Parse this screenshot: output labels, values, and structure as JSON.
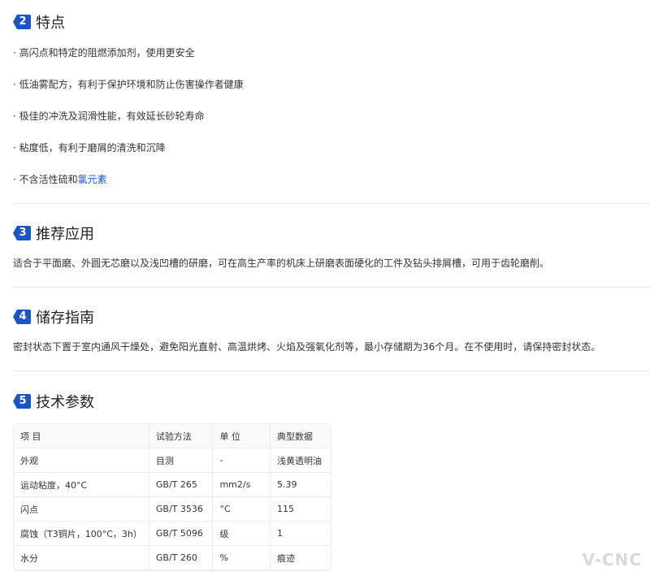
{
  "features": {
    "number": "2",
    "title": "特点",
    "items": [
      {
        "text": "· 高闪点和特定的阻燃添加剂，使用更安全"
      },
      {
        "text": "· 低油雾配方，有利于保护环境和防止伤害操作者健康"
      },
      {
        "text": "· 极佳的冲洗及润滑性能，有效延长砂轮寿命"
      },
      {
        "text": "· 粘度低，有利于磨屑的清洗和沉降"
      },
      {
        "text_prefix": "· 不含活性硫和",
        "link": "氯元素"
      }
    ]
  },
  "applications": {
    "number": "3",
    "title": "推荐应用",
    "text": "适合于平面磨、外圆无芯磨以及浅凹槽的研磨，可在高生产率的机床上研磨表面硬化的工件及钻头排屑槽，可用于齿轮磨削。"
  },
  "storage": {
    "number": "4",
    "title": "储存指南",
    "text": "密封状态下置于室内通风干燥处，避免阳光直射、高温烘烤、火焰及强氧化剂等，最小存储期为36个月。在不使用时，请保持密封状态。"
  },
  "specs": {
    "number": "5",
    "title": "技术参数",
    "headers": [
      "项 目",
      "试验方法",
      "单 位",
      "典型数据"
    ],
    "rows": [
      [
        "外观",
        "目测",
        "-",
        "浅黄透明油"
      ],
      [
        "运动粘度，40°C",
        "GB/T 265",
        "mm2/s",
        "5.39"
      ],
      [
        "闪点",
        "GB/T 3536",
        "°C",
        "115"
      ],
      [
        "腐蚀（T3铜片，100°C，3h）",
        "GB/T 5096",
        "级",
        "1"
      ],
      [
        "水分",
        "GB/T 260",
        "%",
        "痕迹"
      ]
    ]
  },
  "watermark": "V-CNC",
  "colors": {
    "accent": "#1a55c8",
    "divider": "#e8e8e8"
  }
}
